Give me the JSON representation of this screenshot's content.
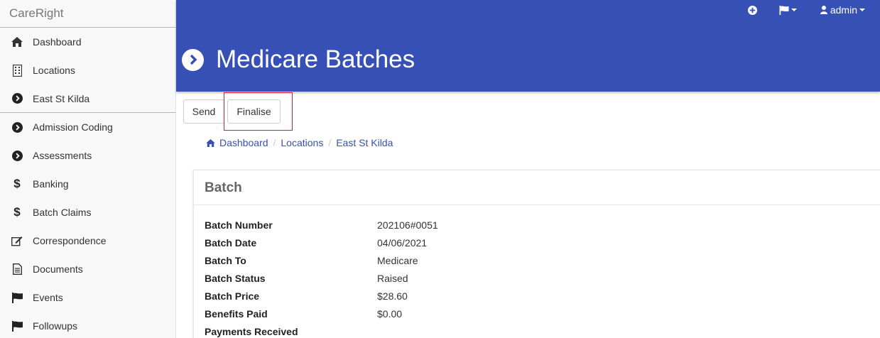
{
  "sidebar": {
    "brand": "CareRight",
    "items": [
      {
        "label": "Dashboard",
        "icon": "home-icon"
      },
      {
        "label": "Locations",
        "icon": "building-icon"
      },
      {
        "label": "East St Kilda",
        "icon": "chevron-circle-right-icon"
      },
      {
        "label": "Admission Coding",
        "icon": "chevron-circle-right-icon"
      },
      {
        "label": "Assessments",
        "icon": "chevron-circle-right-icon"
      },
      {
        "label": "Banking",
        "icon": "dollar-icon"
      },
      {
        "label": "Batch Claims",
        "icon": "dollar-icon"
      },
      {
        "label": "Correspondence",
        "icon": "edit-icon"
      },
      {
        "label": "Documents",
        "icon": "document-icon"
      },
      {
        "label": "Events",
        "icon": "flag-icon"
      },
      {
        "label": "Followups",
        "icon": "flag-icon"
      }
    ]
  },
  "header": {
    "title": "Medicare Batches",
    "user": "admin",
    "accent": "#3650b5"
  },
  "toolbar": {
    "send_label": "Send",
    "finalise_label": "Finalise",
    "highlight_color": "#e01b2c"
  },
  "breadcrumb": [
    "Dashboard",
    "Locations",
    "East St Kilda"
  ],
  "panel": {
    "title": "Batch",
    "rows": [
      {
        "label": "Batch Number",
        "value": "202106#0051"
      },
      {
        "label": "Batch Date",
        "value": "04/06/2021"
      },
      {
        "label": "Batch To",
        "value": "Medicare"
      },
      {
        "label": "Batch Status",
        "value": "Raised"
      },
      {
        "label": "Batch Price",
        "value": "$28.60"
      },
      {
        "label": "Benefits Paid",
        "value": "$0.00"
      },
      {
        "label": "Payments Received",
        "value": ""
      }
    ]
  }
}
